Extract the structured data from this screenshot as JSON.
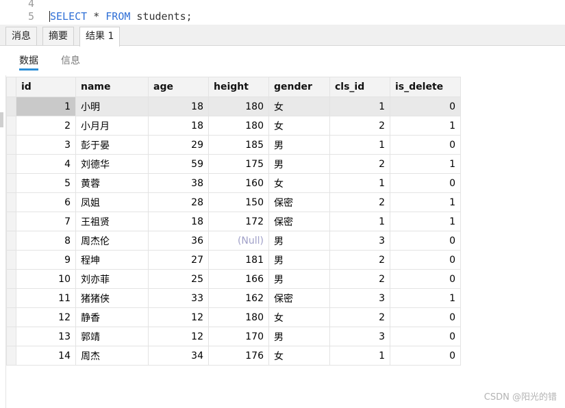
{
  "editor": {
    "lines": [
      {
        "num": "4",
        "code": ""
      },
      {
        "num": "5",
        "kw1": "SELECT",
        "mid": " * ",
        "kw2": "FROM",
        "rest": " students;"
      }
    ]
  },
  "tabs": [
    "消息",
    "摘要",
    "结果 1"
  ],
  "subtabs": [
    "数据",
    "信息"
  ],
  "table": {
    "columns": [
      "id",
      "name",
      "age",
      "height",
      "gender",
      "cls_id",
      "is_delete"
    ],
    "rows": [
      [
        "1",
        "小明",
        "18",
        "180",
        "女",
        "1",
        "0"
      ],
      [
        "2",
        "小月月",
        "18",
        "180",
        "女",
        "2",
        "1"
      ],
      [
        "3",
        "彭于晏",
        "29",
        "185",
        "男",
        "1",
        "0"
      ],
      [
        "4",
        "刘德华",
        "59",
        "175",
        "男",
        "2",
        "1"
      ],
      [
        "5",
        "黄蓉",
        "38",
        "160",
        "女",
        "1",
        "0"
      ],
      [
        "6",
        "凤姐",
        "28",
        "150",
        "保密",
        "2",
        "1"
      ],
      [
        "7",
        "王祖贤",
        "18",
        "172",
        "保密",
        "1",
        "1"
      ],
      [
        "8",
        "周杰伦",
        "36",
        "(Null)",
        "男",
        "3",
        "0"
      ],
      [
        "9",
        "程坤",
        "27",
        "181",
        "男",
        "2",
        "0"
      ],
      [
        "10",
        "刘亦菲",
        "25",
        "166",
        "男",
        "2",
        "0"
      ],
      [
        "11",
        "猪猪侠",
        "33",
        "162",
        "保密",
        "3",
        "1"
      ],
      [
        "12",
        "静香",
        "12",
        "180",
        "女",
        "2",
        "0"
      ],
      [
        "13",
        "郭靖",
        "12",
        "170",
        "男",
        "3",
        "0"
      ],
      [
        "14",
        "周杰",
        "34",
        "176",
        "女",
        "1",
        "0"
      ]
    ]
  },
  "watermark": "CSDN @阳光的错",
  "colors": {
    "keyword": "#2f6fd6",
    "subtab_underline": "#2a8dd6",
    "null_text": "#a0a0c8"
  }
}
